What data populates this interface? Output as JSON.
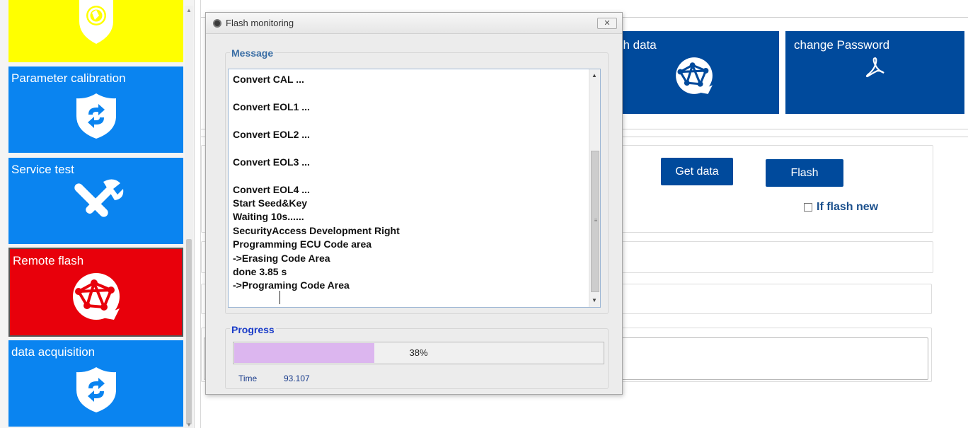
{
  "sidebar": {
    "tiles": [
      {
        "label": ""
      },
      {
        "label": "Parameter calibration"
      },
      {
        "label": "Service test"
      },
      {
        "label": "Remote flash"
      },
      {
        "label": "data acquisition"
      }
    ]
  },
  "nav_tiles": [
    {
      "label": "sh data"
    },
    {
      "label": "change Password"
    }
  ],
  "actions": {
    "get_data": "Get data",
    "flash": "Flash",
    "if_flash_new": "If flash new"
  },
  "dialog": {
    "title": "Flash monitoring",
    "close": "✕",
    "message_group": "Message",
    "messages": [
      "Convert CAL ...",
      "Convert EOL1 ...",
      "Convert EOL2 ...",
      "Convert EOL3 ...",
      "Convert EOL4 ...",
      "Start Seed&Key",
      "Waiting 10s......",
      "SecurityAccess Development Right",
      "Programming ECU Code area",
      "->Erasing Code Area",
      "done  3.85 s",
      "->Programing Code Area"
    ],
    "progress_group": "Progress",
    "progress_percent": 38,
    "progress_text": "38%",
    "time_label": "Time",
    "time_value": "93.107"
  },
  "colors": {
    "tile_yellow": "#ffff00",
    "tile_blue": "#0a84f0",
    "tile_red": "#e8000b",
    "nav_blue": "#004a9c",
    "progress_fill": "#dcb6ef",
    "message_label": "#3a6ea5",
    "progress_label": "#1a3cc8"
  },
  "icons": [
    "globe-shield-icon",
    "refresh-shield-icon",
    "wrench-screwdriver-icon",
    "network-globe-icon",
    "refresh-shield-icon",
    "network-globe-icon",
    "acrobat-icon"
  ]
}
